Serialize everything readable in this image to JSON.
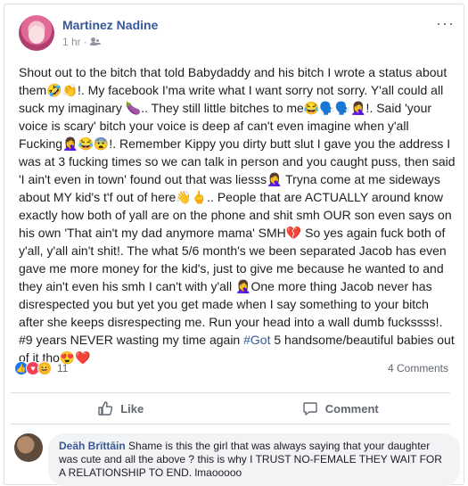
{
  "post": {
    "author": "Martinez Nadine",
    "time": "1 hr",
    "audience_icon": "friends-icon",
    "more_label": "···",
    "text_1": "Shout out to the bitch that told Babydaddy and his bitch I wrote a status about them🤣👏!. My facebook I'ma write what I want sorry not sorry. Y'all could all suck my imaginary 🍆.. They still little bitches to me😂🗣️🗣️🤦‍♀️!. Said 'your voice is scary' bitch your voice is deep af can't even imagine when y'all Fucking🤦‍♀️😂😨!. Remember Kippy you dirty butt slut I gave you the address I was at 3 fucking times so we can talk in person and you caught puss, then said 'I ain't even in town' found out that was liesss🤦‍♀️ Tryna come at me sideways about MY kid's t'f out of here👋🖕.. People that are ACTUALLY around know exactly how both of yall are on the phone and shit smh OUR son even says on his own 'That ain't my dad anymore mama' SMH💔 So yes again fuck both of y'all, y'all ain't shit!. The what 5/6 month's we been separated Jacob has even gave me more money for the kid's, just to give me because he wanted to and they ain't even his smh I can't with y'all 🤦‍♀️One more thing Jacob never has disrespected you but yet you get made when I say something to your bitch after she keeps disrespecting me. Run your head into a wall dumb fuckssss!. #9 years NEVER wasting my time again ",
    "hashtag": "#Got",
    "text_2": " 5 handsome/beautiful babies out of it tho😍❤️"
  },
  "engagement": {
    "reaction_count": "11",
    "comments_label": "4 Comments",
    "like_label": "Like",
    "comment_label": "Comment"
  },
  "comment": {
    "author": "Deäh Brïttāin",
    "text": " Shame is this the girl that was always saying that your daughter was cute and all the above ? this is why I TRUST NO-FEMALE THEY WAIT FOR A RELATIONSHIP TO END. lmaooooo"
  },
  "colors": {
    "link_blue": "#365899",
    "like_blue": "#1877f2",
    "love_red": "#f33e58",
    "haha_yellow": "#f7b125"
  }
}
